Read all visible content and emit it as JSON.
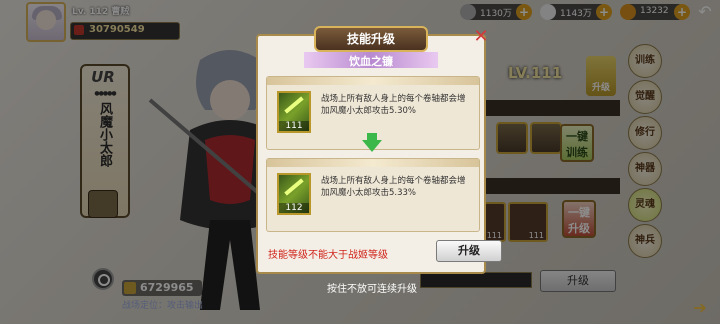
{
  "player": {
    "level": "Lv. 112",
    "name": "曹贼",
    "power": "30790549"
  },
  "hero": {
    "rarity": "UR",
    "name": "风魔小太郎",
    "power": "6729965",
    "battle_position": "战场定位：攻击输出"
  },
  "currencies": [
    {
      "icon": "silver-coin-icon",
      "value": "1130万",
      "color": "#c0c0c0"
    },
    {
      "icon": "rice-ball-icon",
      "value": "1143万",
      "color": "#f0f0f0"
    },
    {
      "icon": "gold-ingot-icon",
      "value": "13232",
      "color": "#e0a020"
    }
  ],
  "right_panel": {
    "level": "LV.111",
    "upgrade_label": "升级",
    "one_click_train": "一键训练",
    "one_click_upgrade": "一键升级",
    "skill_slot_levels": [
      "111",
      "111"
    ],
    "upgrade_button": "升级",
    "tabs": [
      "训练",
      "觉醒",
      "修行",
      "神器",
      "灵魂",
      "神兵"
    ],
    "active_tab": "灵魂",
    "progress_fraction": 0.0
  },
  "dialog": {
    "title": "技能升级",
    "skill_name": "饮血之镰",
    "current": {
      "level": "111",
      "desc": "战场上所有敌人身上的每个卷轴都会增加风魔小太郎攻击5.30%"
    },
    "next": {
      "level": "112",
      "desc": "战场上所有敌人身上的每个卷轴都会增加风魔小太郎攻击5.33%"
    },
    "warning": "技能等级不能大于战姬等级",
    "upgrade_button": "升级"
  },
  "hold_hint": "按住不放可连续升级"
}
